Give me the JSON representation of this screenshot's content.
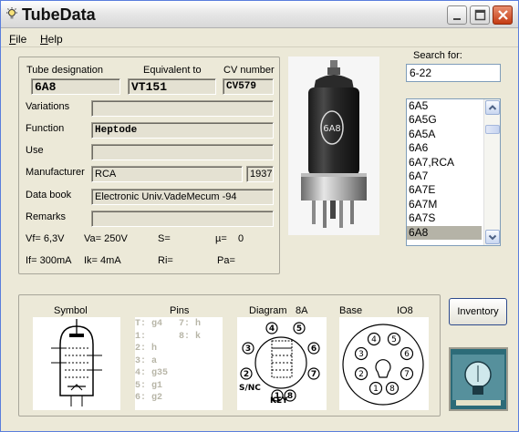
{
  "window": {
    "title": "TubeData"
  },
  "menu": {
    "file": "File",
    "file_rest": "ile",
    "help": "Help",
    "help_rest": "elp"
  },
  "labels": {
    "tube_designation": "Tube designation",
    "equivalent_to": "Equivalent to",
    "cv_number": "CV number",
    "variations": "Variations",
    "function": "Function",
    "use": "Use",
    "manufacturer": "Manufacturer",
    "data_book": "Data book",
    "remarks": "Remarks"
  },
  "values": {
    "tube_designation": "6A8",
    "equivalent_to": "VT151",
    "cv_number": "CV579",
    "variations": "",
    "function": "Heptode",
    "use": "",
    "manufacturer": "RCA",
    "year": "1937",
    "data_book": "Electronic Univ.VadeMecum -94",
    "remarks": ""
  },
  "params": {
    "vf": "Vf= 6,3V",
    "va": "Va= 250V",
    "s": "S=",
    "mu": "µ=",
    "mu_val": "0",
    "if": "If= 300mA",
    "ik": "Ik= 4mA",
    "ri": "Ri=",
    "pa": "Pa="
  },
  "search": {
    "label": "Search for:",
    "value": "6-22"
  },
  "tube_list": [
    "6A5",
    "6A5G",
    "6A5A",
    "6A6",
    "6A7,RCA",
    "6A7",
    "6A7E",
    "6A7M",
    "6A7S",
    "6A8"
  ],
  "selected_tube": "6A8",
  "bottom": {
    "symbol": "Symbol",
    "pins": "Pins",
    "diagram": "Diagram",
    "diagram_code": "8A",
    "base": "Base",
    "base_code": "IO8"
  },
  "pin_list_left": [
    "T: g4",
    "1:",
    "2: h",
    "3: a",
    "4: g35",
    "5: g1",
    "6: g2"
  ],
  "pin_list_right": [
    "7: h",
    "8: k"
  ],
  "diagram_text": {
    "sinc": "S/NC",
    "key": "KEY"
  },
  "diagram_pins": [
    "1",
    "2",
    "3",
    "4",
    "5",
    "6",
    "7",
    "8"
  ],
  "base_pins": [
    "1",
    "2",
    "3",
    "4",
    "5",
    "6",
    "7",
    "8"
  ],
  "photo_label": "6A8",
  "buttons": {
    "inventory": "Inventory"
  },
  "colors": {
    "window_bg": "#ece9d8",
    "close_btn": "#c43b13",
    "selection": "#b5b3a7"
  }
}
